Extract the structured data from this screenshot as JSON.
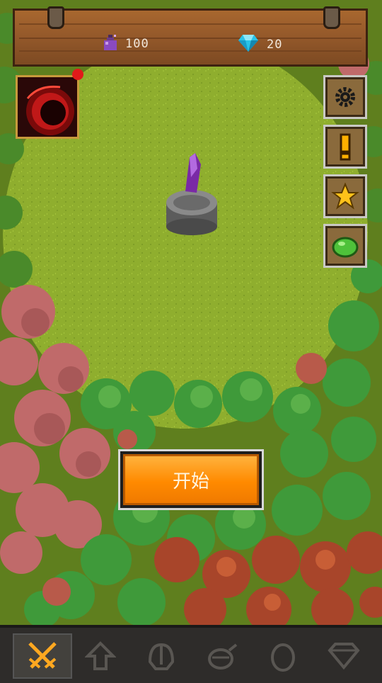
{
  "resources": {
    "potion": {
      "icon": "purple-potion-icon",
      "value": "100"
    },
    "gem": {
      "icon": "diamond-icon",
      "value": "20"
    }
  },
  "portal": {
    "icon": "dark-portal-icon",
    "has_notification": true
  },
  "side_buttons": [
    {
      "name": "settings-button",
      "icon": "gear-icon"
    },
    {
      "name": "alert-button",
      "icon": "exclamation-icon"
    },
    {
      "name": "favorites-button",
      "icon": "star-icon"
    },
    {
      "name": "slime-button",
      "icon": "slime-icon"
    }
  ],
  "start_button": {
    "label": "开始"
  },
  "bottom_nav": [
    {
      "icon": "crossed-swords-icon",
      "active": true
    },
    {
      "icon": "up-arrow-icon",
      "active": false
    },
    {
      "icon": "helmet-icon",
      "active": false
    },
    {
      "icon": "pot-icon",
      "active": false
    },
    {
      "icon": "egg-icon",
      "active": false
    },
    {
      "icon": "diamond-outline-icon",
      "active": false
    }
  ],
  "colors": {
    "grass": "#8fae2e",
    "start_button": "#ff8a00",
    "wood": "#93582a",
    "notification": "#e11a1a"
  }
}
